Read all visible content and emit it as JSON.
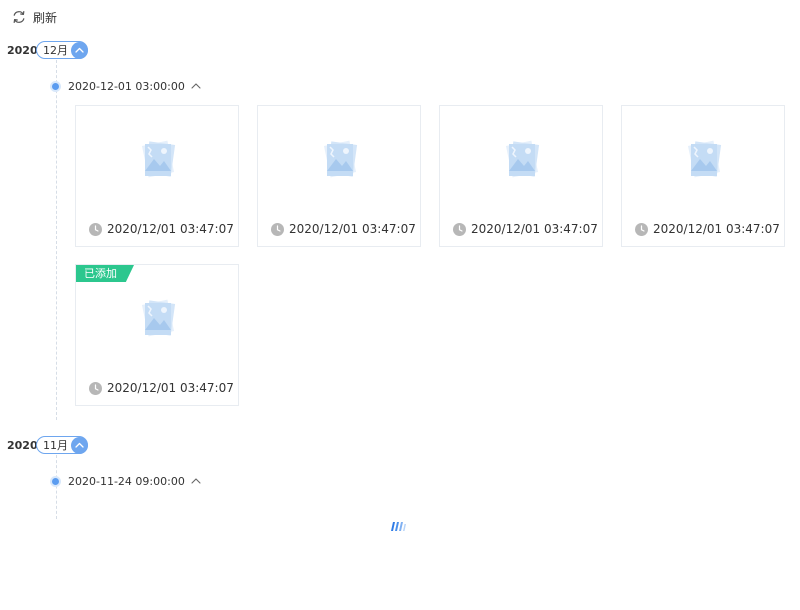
{
  "toolbar": {
    "refresh_label": "刷新",
    "refresh_icon": "refresh-icon"
  },
  "colors": {
    "accent": "#6ea6ef",
    "added_tag": "#2cc78e",
    "border": "#e8ecf1"
  },
  "groups": [
    {
      "year": "2020",
      "month": "12月",
      "dates": [
        {
          "datetime": "2020-12-01 03:00:00",
          "items": [
            {
              "time": "2020/12/01 03:47:07",
              "tag": ""
            },
            {
              "time": "2020/12/01 03:47:07",
              "tag": ""
            },
            {
              "time": "2020/12/01 03:47:07",
              "tag": ""
            },
            {
              "time": "2020/12/01 03:47:07",
              "tag": ""
            },
            {
              "time": "2020/12/01 03:47:07",
              "tag": "已添加"
            }
          ]
        }
      ]
    },
    {
      "year": "2020",
      "month": "11月",
      "dates": [
        {
          "datetime": "2020-11-24 09:00:00",
          "items": []
        }
      ]
    }
  ]
}
